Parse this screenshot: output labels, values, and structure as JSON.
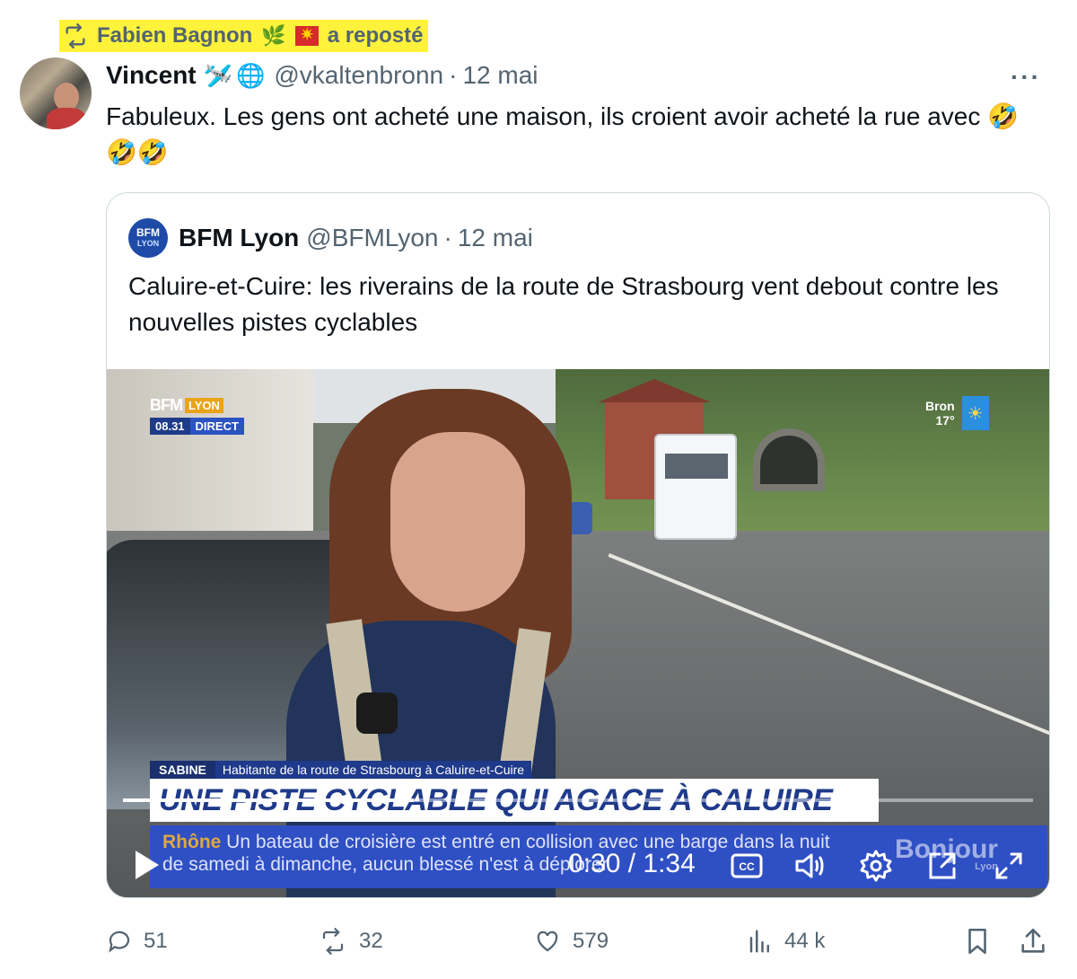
{
  "repost": {
    "user": "Fabien Bagnon",
    "suffix": "a reposté",
    "badges": [
      "🌿"
    ]
  },
  "tweet": {
    "author_name": "Vincent",
    "badges": [
      "🛩️",
      "🌐"
    ],
    "handle": "@vkaltenbronn",
    "date": "12 mai",
    "more_label": "···",
    "text": "Fabuleux. Les gens ont acheté une maison, ils croient avoir acheté la rue avec 🤣🤣🤣"
  },
  "quote": {
    "logo_line1": "BFM",
    "logo_line2": "LYON",
    "author_name": "BFM Lyon",
    "handle": "@BFMLyon",
    "date": "12 mai",
    "text": "Caluire-et-Cuire: les riverains de la route de Strasbourg vent debout contre les nouvelles pistes cyclables"
  },
  "video": {
    "bug_brand": "BFM",
    "bug_city": "LYON",
    "bug_time": "08.31",
    "bug_live": "DIRECT",
    "weather_city": "Bron",
    "weather_temp": "17°",
    "lower_third_name": "SABINE",
    "lower_third_desc": "Habitante de la route de Strasbourg à Caluire-et-Cuire",
    "headline": "UNE PISTE CYCLABLE QUI AGACE À CALUIRE",
    "ticker_region": "Rhône",
    "ticker_text": "Un bateau de croisière est entré en collision avec une barge dans la nuit de samedi à dimanche, aucun blessé n'est à déplorer",
    "program_logo": "Bonjour",
    "program_logo_sub": "Lyon",
    "timecode": "0:30 / 1:34",
    "progress_fraction": 0.32,
    "cc_label": "CC"
  },
  "actions": {
    "replies": "51",
    "reposts": "32",
    "likes": "579",
    "views": "44 k"
  },
  "colors": {
    "text_primary": "#0f1419",
    "text_secondary": "#536471",
    "border": "#cfd9de",
    "highlight": "#fff23a",
    "bfm_blue": "#1f3a8a"
  }
}
